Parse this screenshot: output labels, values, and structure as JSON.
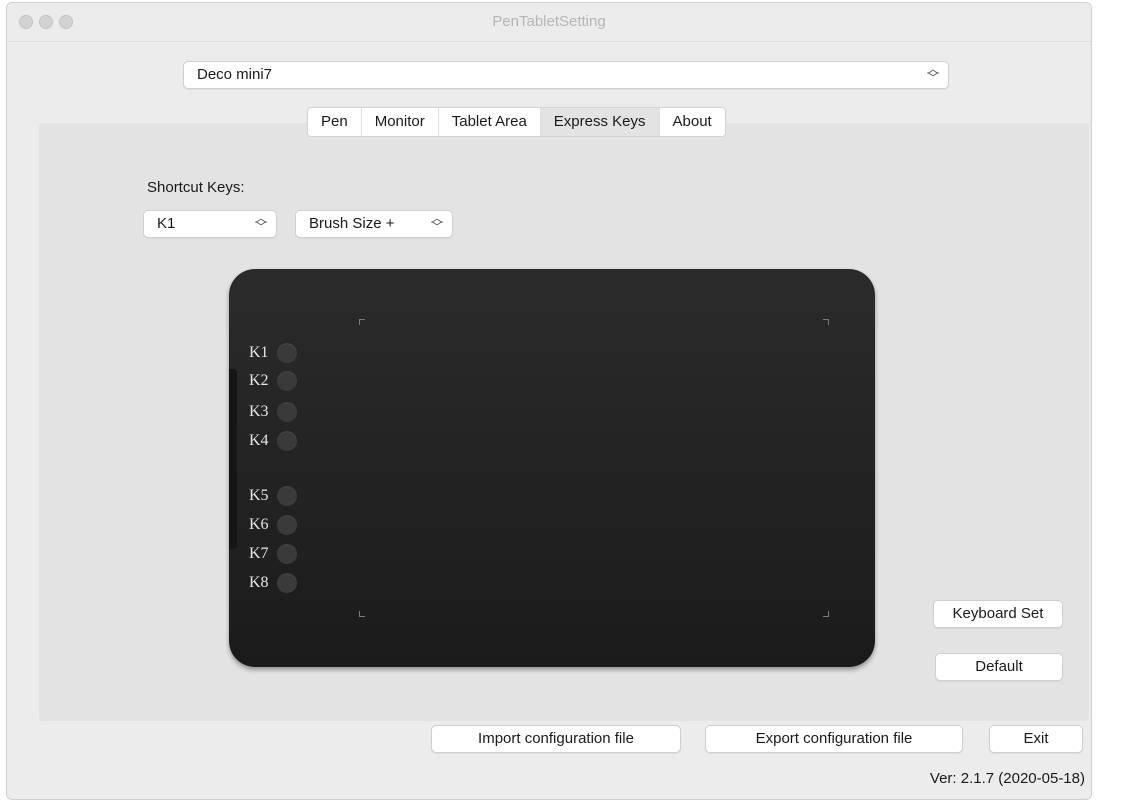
{
  "window": {
    "title": "PenTabletSetting"
  },
  "device_select": {
    "value": "Deco mini7"
  },
  "tabs": [
    {
      "label": "Pen",
      "active": false
    },
    {
      "label": "Monitor",
      "active": false
    },
    {
      "label": "Tablet Area",
      "active": false
    },
    {
      "label": "Express Keys",
      "active": true
    },
    {
      "label": "About",
      "active": false
    }
  ],
  "shortcut": {
    "label": "Shortcut Keys:",
    "key_select": "K1",
    "action_select": "Brush Size +"
  },
  "tablet": {
    "keys": [
      "K1",
      "K2",
      "K3",
      "K4",
      "K5",
      "K6",
      "K7",
      "K8"
    ]
  },
  "buttons": {
    "keyboard_set": "Keyboard Set",
    "default": "Default",
    "import": "Import configuration file",
    "export": "Export configuration file",
    "exit": "Exit"
  },
  "version": "Ver: 2.1.7 (2020-05-18)",
  "icons": {
    "popup_arrows": "up-down-chevron-icon",
    "traffic_lights": "window-controls-icon"
  }
}
